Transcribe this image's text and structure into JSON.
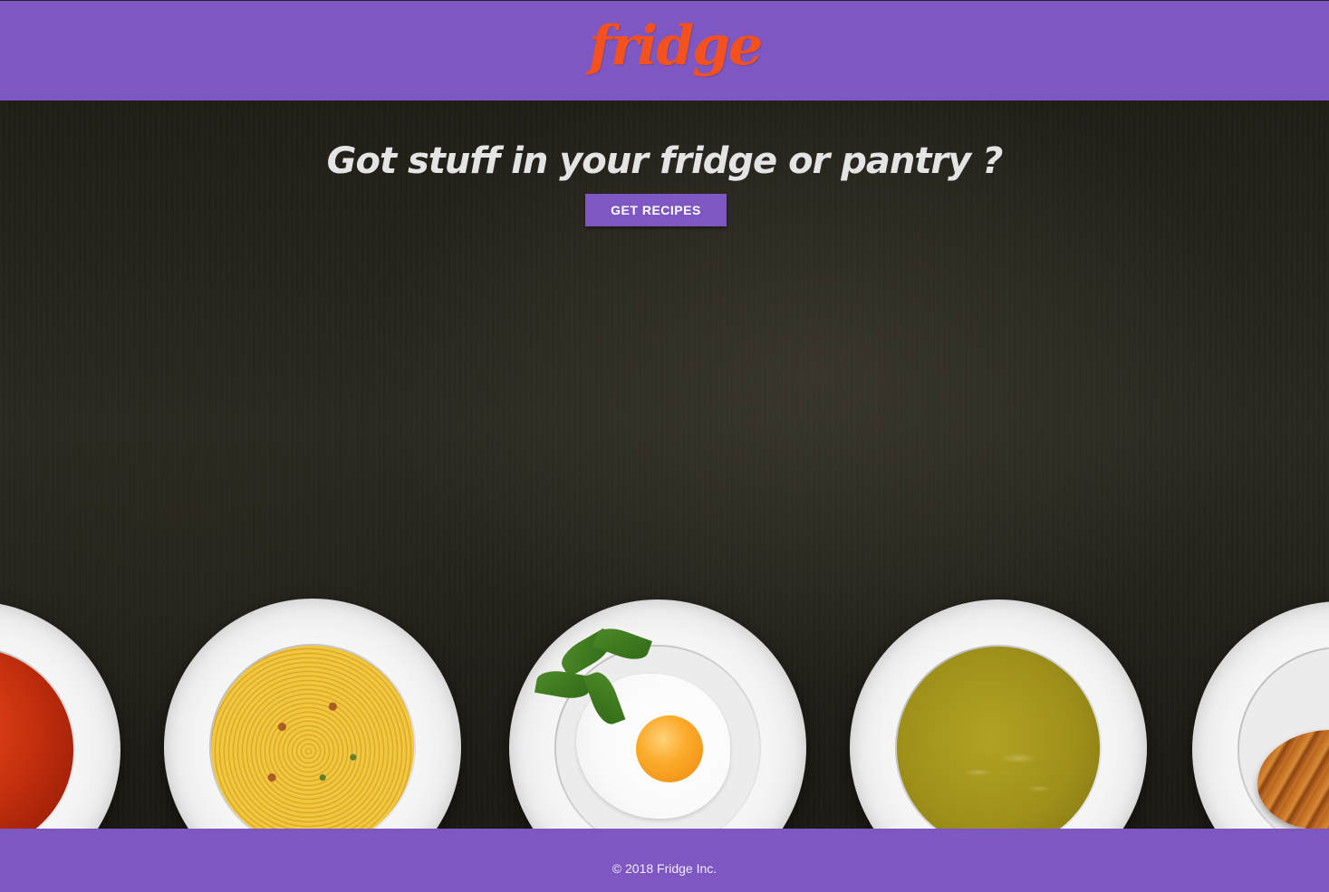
{
  "navbar": {
    "brand": "fridge"
  },
  "hero": {
    "headline": "Got stuff in your fridge or pantry ?",
    "cta_label": "GET RECIPES",
    "plates": [
      {
        "food": "tomato-soup"
      },
      {
        "food": "spaghetti"
      },
      {
        "food": "fried-egg"
      },
      {
        "food": "pea-soup"
      },
      {
        "food": "croissant"
      }
    ]
  },
  "footer": {
    "copyright": "© 2018 Fridge Inc."
  },
  "colors": {
    "primary": "#7e57c2",
    "brand": "#f4511e",
    "headline": "#e4e4e4",
    "background": "#201e17"
  }
}
